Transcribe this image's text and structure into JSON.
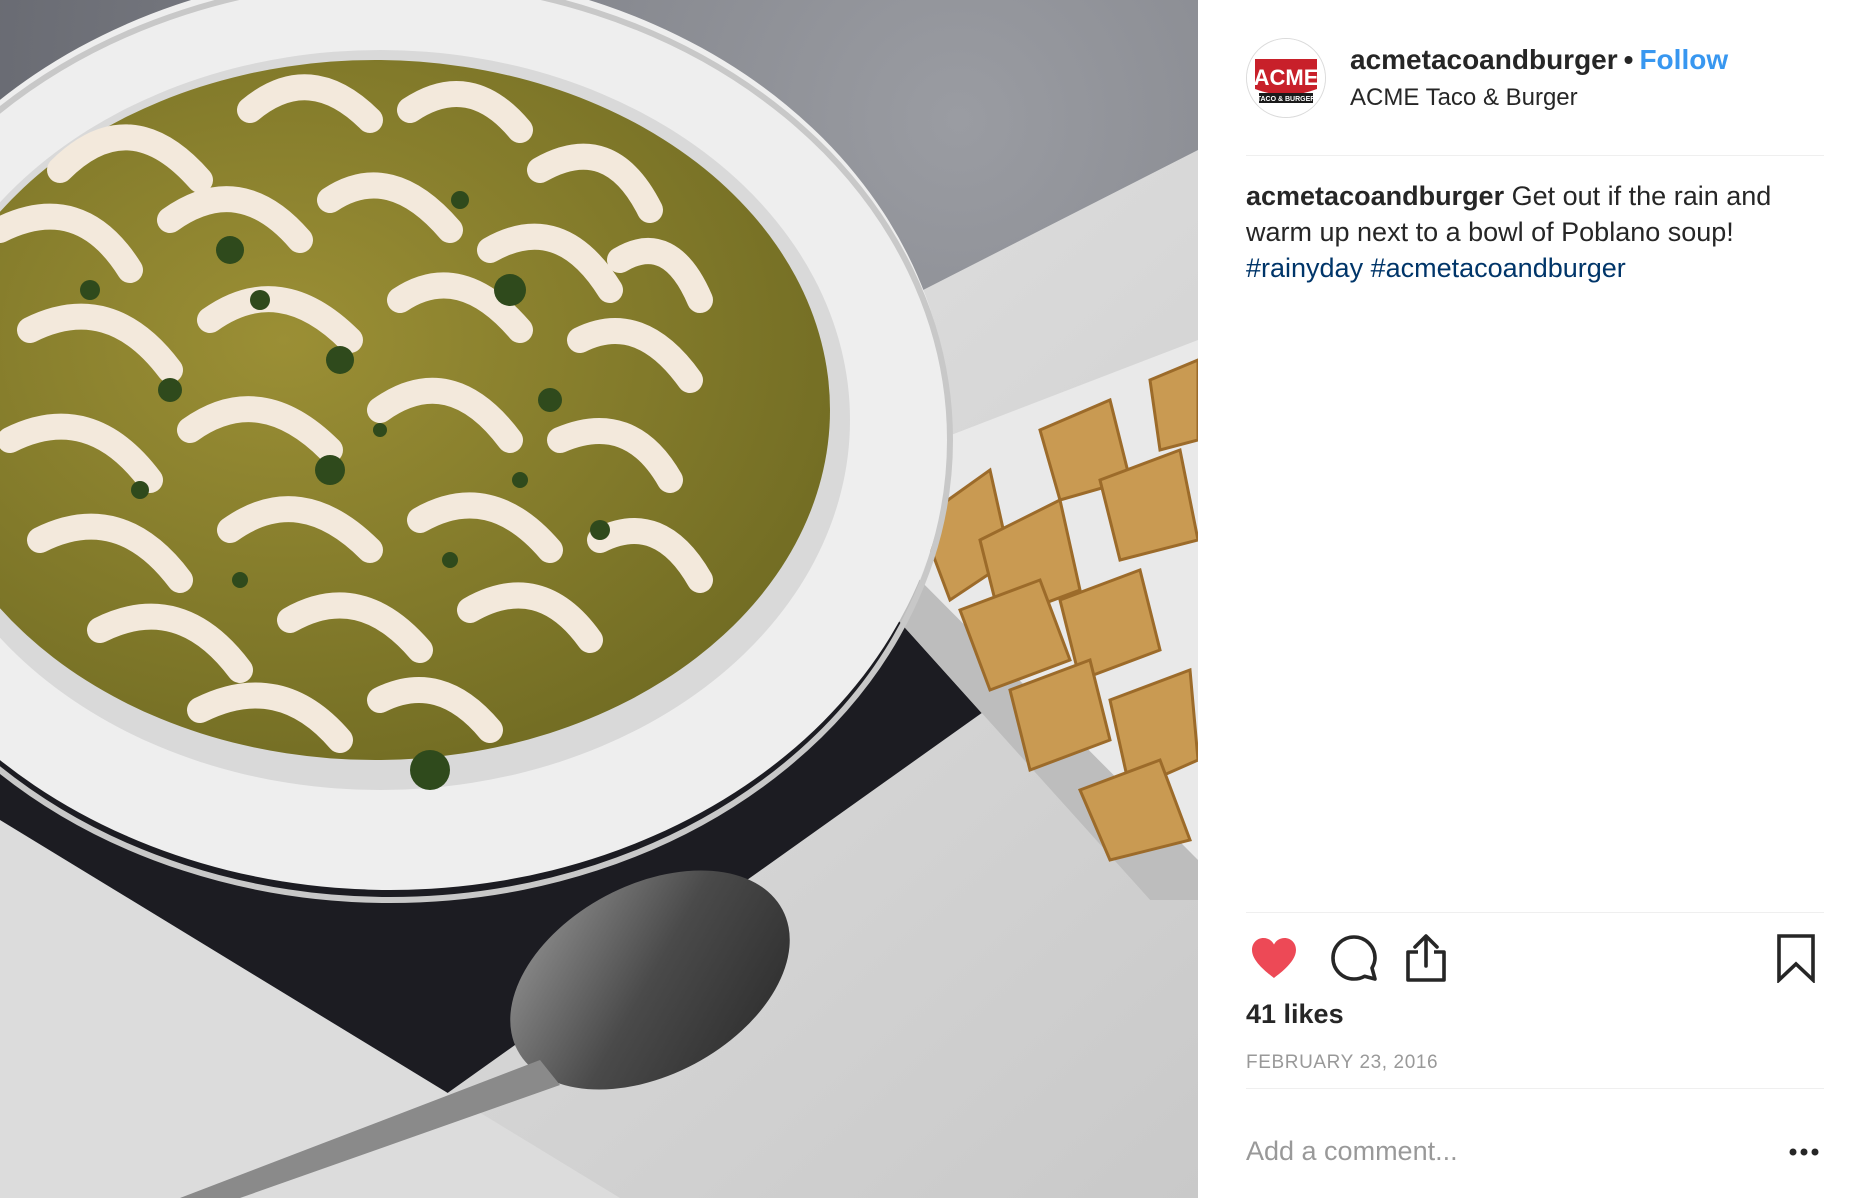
{
  "post": {
    "username": "acmetacoandburger",
    "separator": "•",
    "follow_label": "Follow",
    "location": "ACME Taco & Burger",
    "avatar_logo": {
      "main": "ACME",
      "sub": "TACO & BURGER"
    },
    "caption": {
      "username": "acmetacoandburger",
      "text": "Get out if the rain and warm up next to a bowl of Poblano soup!",
      "hashtags": [
        "#rainyday",
        "#acmetacoandburger"
      ]
    },
    "likes": "41 likes",
    "date": "FEBRUARY 23, 2016",
    "comment_placeholder": "Add a comment...",
    "icons": {
      "like": "heart-icon",
      "comment": "comment-icon",
      "share": "share-icon",
      "save": "bookmark-icon",
      "more": "more-options-icon"
    },
    "colors": {
      "like": "#ed4956",
      "follow": "#3897f0",
      "hashtag": "#003569",
      "muted": "#999999",
      "brand_red": "#c8202a"
    }
  }
}
